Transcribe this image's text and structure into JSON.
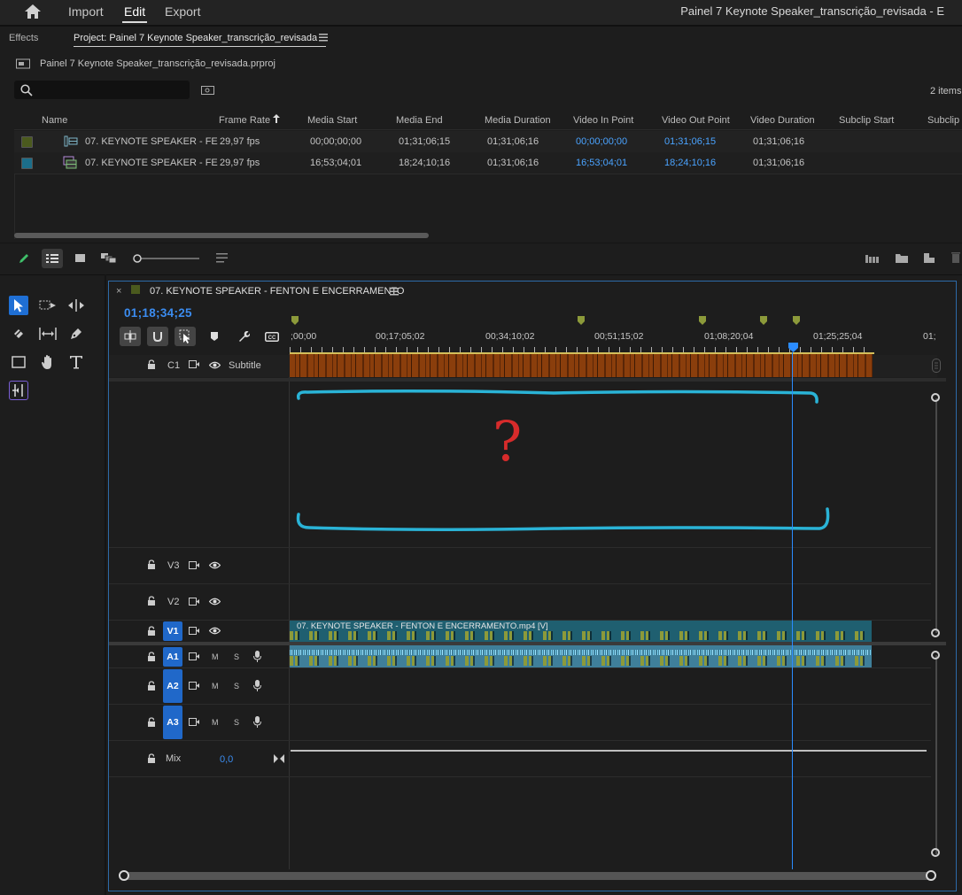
{
  "menu": {
    "home_icon": "home-icon",
    "items": [
      "Import",
      "Edit",
      "Export"
    ],
    "active": "Edit",
    "window_title": "Painel 7 Keynote Speaker_transcrição_revisada - E"
  },
  "panels": {
    "effects_tab": "Effects",
    "project_tab": "Project: Painel 7 Keynote Speaker_transcrição_revisada"
  },
  "project": {
    "file_name": "Painel 7 Keynote Speaker_transcrição_revisada.prproj",
    "search_value": "",
    "item_count": "2 items",
    "columns": [
      "Name",
      "Frame Rate",
      "Media Start",
      "Media End",
      "Media Duration",
      "Video In Point",
      "Video Out Point",
      "Video Duration",
      "Subclip Start",
      "Subclip"
    ],
    "sort_column": "Frame Rate",
    "rows": [
      {
        "color": "#4b5a1e",
        "name": "07. KEYNOTE SPEAKER - FE",
        "frame_rate": "29,97 fps",
        "media_start": "00;00;00;00",
        "media_end": "01;31;06;15",
        "media_duration": "01;31;06;16",
        "video_in": "00;00;00;00",
        "video_out": "01;31;06;15",
        "video_duration": "01;31;06;16"
      },
      {
        "color": "#1c6e8a",
        "name": "07. KEYNOTE SPEAKER - FE",
        "frame_rate": "29,97 fps",
        "media_start": "16;53;04;01",
        "media_end": "18;24;10;16",
        "media_duration": "01;31;06;16",
        "video_in": "16;53;04;01",
        "video_out": "18;24;10;16",
        "video_duration": "01;31;06;16"
      }
    ]
  },
  "timeline": {
    "sequence_name": "07. KEYNOTE SPEAKER - FENTON E ENCERRAMENTO",
    "timecode": "01;18;34;25",
    "ruler_labels": [
      ";00;00",
      "00;17;05;02",
      "00;34;10;02",
      "00;51;15;02",
      "01;08;20;04",
      "01;25;25;04",
      "01;"
    ],
    "tracks": {
      "c1": {
        "label": "C1",
        "name": "Subtitle"
      },
      "v3": "V3",
      "v2": "V2",
      "v1": "V1",
      "a1": "A1",
      "a2": "A2",
      "a3": "A3",
      "mix": {
        "label": "Mix",
        "value": "0,0"
      }
    },
    "mute_label": "M",
    "solo_label": "S",
    "video_clip_name": "07. KEYNOTE SPEAKER - FENTON E ENCERRAMENTO.mp4 [V]",
    "annotation_mark": "?"
  },
  "colors": {
    "accent_blue": "#2b8cff",
    "subtitle_clip": "#8a3e0c",
    "video_clip": "#1f5f70",
    "audio_clip": "#3f7f9a",
    "marker": "#8c9a3a",
    "annotation_cyan": "#2ab3d6",
    "annotation_red": "#d72b2b"
  }
}
